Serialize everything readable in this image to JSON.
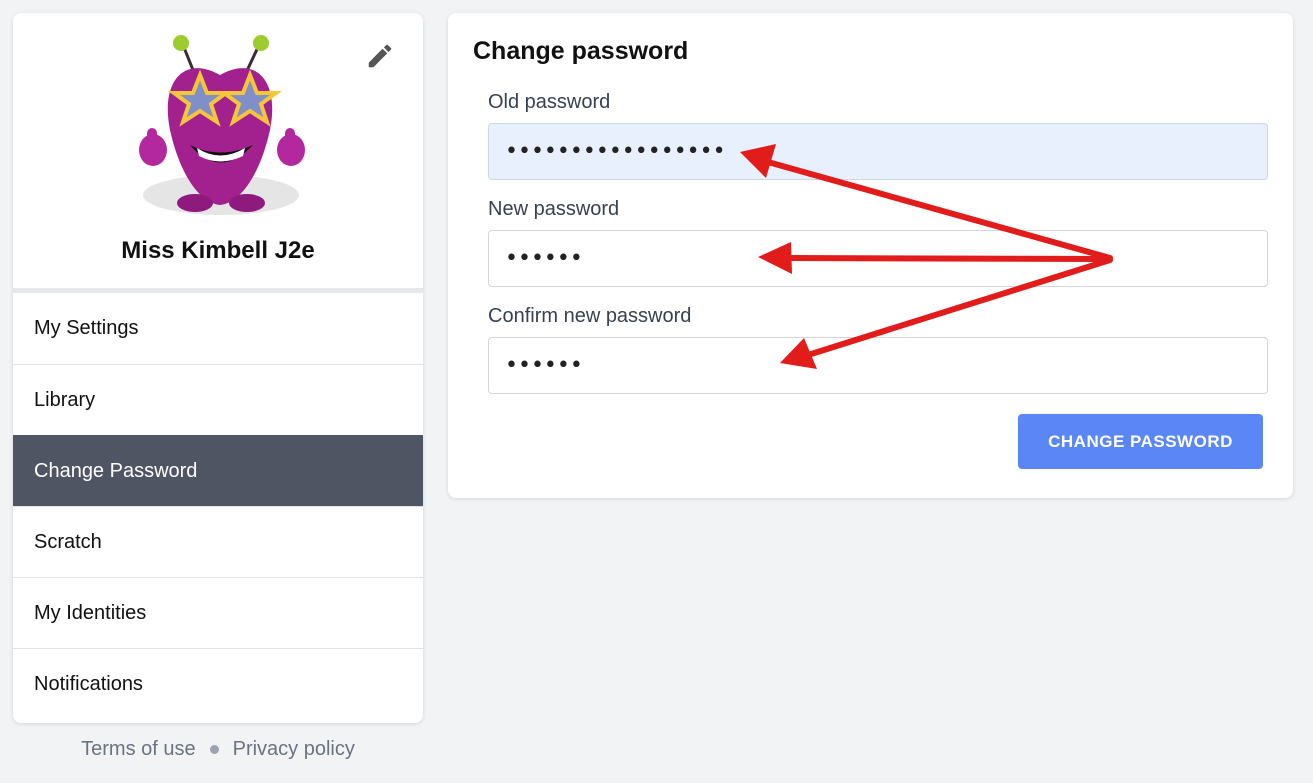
{
  "profile": {
    "name": "Miss Kimbell J2e"
  },
  "sidebar": {
    "items": [
      {
        "label": "My Settings",
        "active": false
      },
      {
        "label": "Library",
        "active": false
      },
      {
        "label": "Change Password",
        "active": true
      },
      {
        "label": "Scratch",
        "active": false
      },
      {
        "label": "My Identities",
        "active": false
      },
      {
        "label": "Notifications",
        "active": false
      }
    ]
  },
  "footer": {
    "terms_label": "Terms of use",
    "privacy_label": "Privacy policy"
  },
  "form": {
    "title": "Change password",
    "old_password": {
      "label": "Old password",
      "value": "•••••••••••••••••"
    },
    "new_password": {
      "label": "New password",
      "value": "••••••"
    },
    "confirm_password": {
      "label": "Confirm new password",
      "value": "••••••"
    },
    "submit_label": "CHANGE PASSWORD"
  },
  "colors": {
    "accent": "#5b86f5",
    "active_nav": "#4f5562",
    "annotation_arrow": "#e21b1b",
    "autofill": "#e8f0fe"
  },
  "icons": {
    "edit": "pencil-icon",
    "avatar": "monster-avatar"
  }
}
